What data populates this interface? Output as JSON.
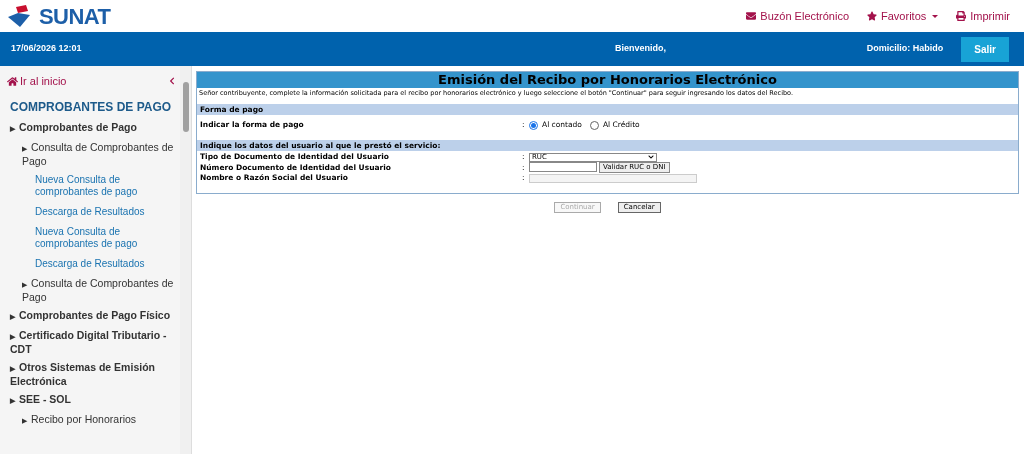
{
  "header": {
    "logo_text": "SUNAT",
    "links": [
      {
        "kind": "mail",
        "label": "Buzón Electrónico"
      },
      {
        "kind": "star",
        "label": "Favoritos",
        "dropdown": true
      },
      {
        "kind": "print",
        "label": "Imprimir"
      }
    ]
  },
  "top_bar": {
    "datetime": "17/06/2026 12:01",
    "welcome": "Bienvenido,",
    "domicilio": "Domicilio: Habido",
    "logout": "Salir"
  },
  "sidebar": {
    "home": "Ir al inicio",
    "marker": "▶",
    "title": "COMPROBANTES DE PAGO",
    "items": [
      {
        "kind": "group",
        "label": "Comprobantes de Pago",
        "children": [
          {
            "kind": "group",
            "label": "Consulta de Comprobantes de Pago",
            "children": [
              {
                "kind": "link",
                "label": "Nueva Consulta de comprobantes de pago"
              },
              {
                "kind": "link",
                "label": "Descarga de Resultados"
              },
              {
                "kind": "link",
                "label": "Nueva Consulta de comprobantes de pago"
              },
              {
                "kind": "link",
                "label": "Descarga de Resultados"
              }
            ]
          },
          {
            "kind": "group",
            "label": "Consulta de Comprobantes de Pago"
          }
        ]
      },
      {
        "kind": "group",
        "label": "Comprobantes de Pago Físico"
      },
      {
        "kind": "group",
        "label": "Certificado Digital Tributario - CDT"
      },
      {
        "kind": "group",
        "label": "Otros Sistemas de Emisión Electrónica"
      },
      {
        "kind": "group",
        "label": "SEE - SOL",
        "children": [
          {
            "kind": "group",
            "label": "Recibo por Honorarios"
          }
        ]
      }
    ]
  },
  "form": {
    "separator": ":",
    "title": "Emisión del Recibo por Honorarios Electrónico",
    "intro": "Señor contribuyente, complete la información solicitada para el recibo por honorarios electrónico y luego seleccione el botón \"Continuar\" para seguir ingresando los datos del Recibo.",
    "sections": [
      {
        "title": "Forma de pago",
        "rows": [
          {
            "kind": "radio",
            "label": "Indicar la forma de pago",
            "options": [
              {
                "label": "Al contado",
                "selected": true
              },
              {
                "label": "Al Crédito",
                "selected": false
              }
            ]
          }
        ]
      },
      {
        "title": "Indique los datos del usuario al que le prestó el servicio:",
        "rows": [
          {
            "kind": "select",
            "label": "Tipo de Documento de Identidad del Usuario",
            "value": "RUC"
          },
          {
            "kind": "input_button",
            "label": "Número Documento de Identidad del Usuario",
            "button": "Validar RUC o DNI"
          },
          {
            "kind": "readonly",
            "label": "Nombre o Razón Social del Usuario"
          }
        ]
      }
    ],
    "buttons": [
      {
        "label": "Continuar",
        "disabled": true
      },
      {
        "label": "Cancelar",
        "disabled": false
      }
    ]
  }
}
